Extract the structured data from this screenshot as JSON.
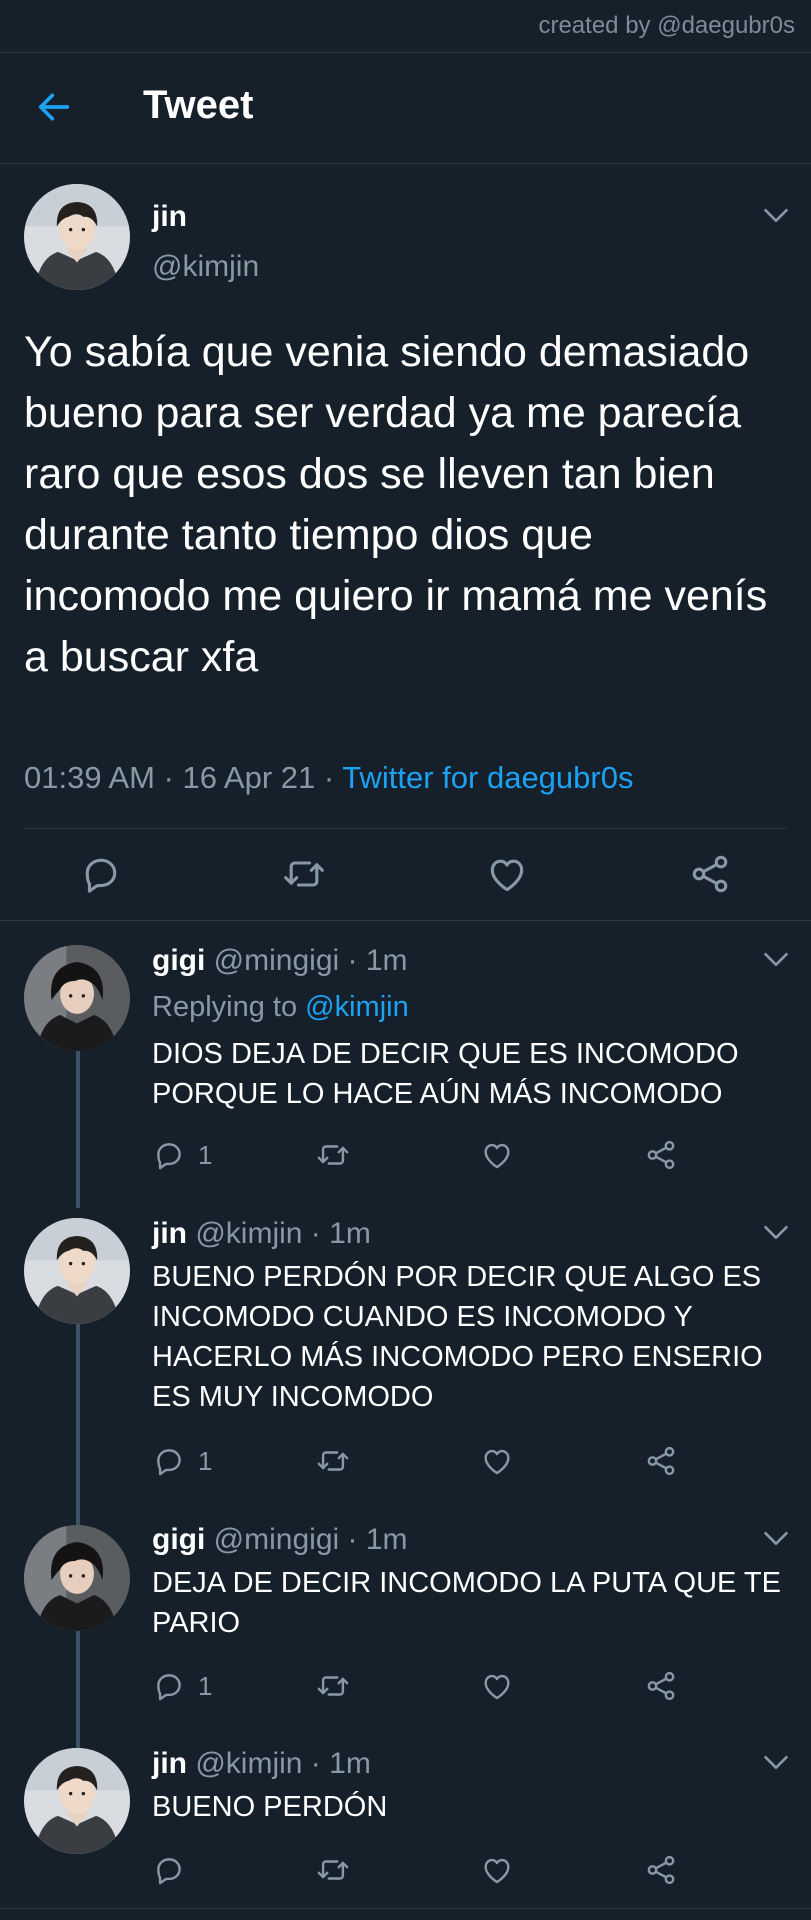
{
  "watermark": "created by @daegubr0s",
  "header": {
    "title": "Tweet"
  },
  "main_tweet": {
    "name": "jin",
    "handle": "@kimjin",
    "text": "Yo sabía que venia siendo demasiado bueno para ser verdad ya me parecía raro que esos dos se lleven tan bien durante tanto tiempo dios que incomodo me quiero ir mamá me venís a buscar xfa",
    "time": "01:39 AM",
    "date": "16 Apr 21",
    "source": "Twitter for daegubr0s"
  },
  "replies": [
    {
      "name": "gigi",
      "handle": "@mingigi",
      "time": "1m",
      "replying_prefix": "Replying to",
      "replying_to": "@kimjin",
      "text": "DIOS DEJA DE DECIR QUE ES INCOMODO PORQUE LO HACE AÚN MÁS INCOMODO",
      "reply_count": "1"
    },
    {
      "name": "jin",
      "handle": "@kimjin",
      "time": "1m",
      "text": "BUENO PERDÓN POR DECIR QUE ALGO ES INCOMODO CUANDO ES INCOMODO Y HACERLO MÁS INCOMODO PERO ENSERIO ES MUY INCOMODO",
      "reply_count": "1"
    },
    {
      "name": "gigi",
      "handle": "@mingigi",
      "time": "1m",
      "text": "DEJA DE DECIR INCOMODO LA PUTA QUE TE PARIO",
      "reply_count": "1"
    },
    {
      "name": "jin",
      "handle": "@kimjin",
      "time": "1m",
      "text": "BUENO PERDÓN",
      "reply_count": ""
    }
  ],
  "colors": {
    "background": "#15202b",
    "accent": "#1da1f2",
    "secondary_text": "#8899a6",
    "divider": "#2c3a47"
  },
  "icons": [
    "back-arrow-icon",
    "chevron-down-icon",
    "reply-icon",
    "retweet-icon",
    "like-icon",
    "share-icon"
  ]
}
